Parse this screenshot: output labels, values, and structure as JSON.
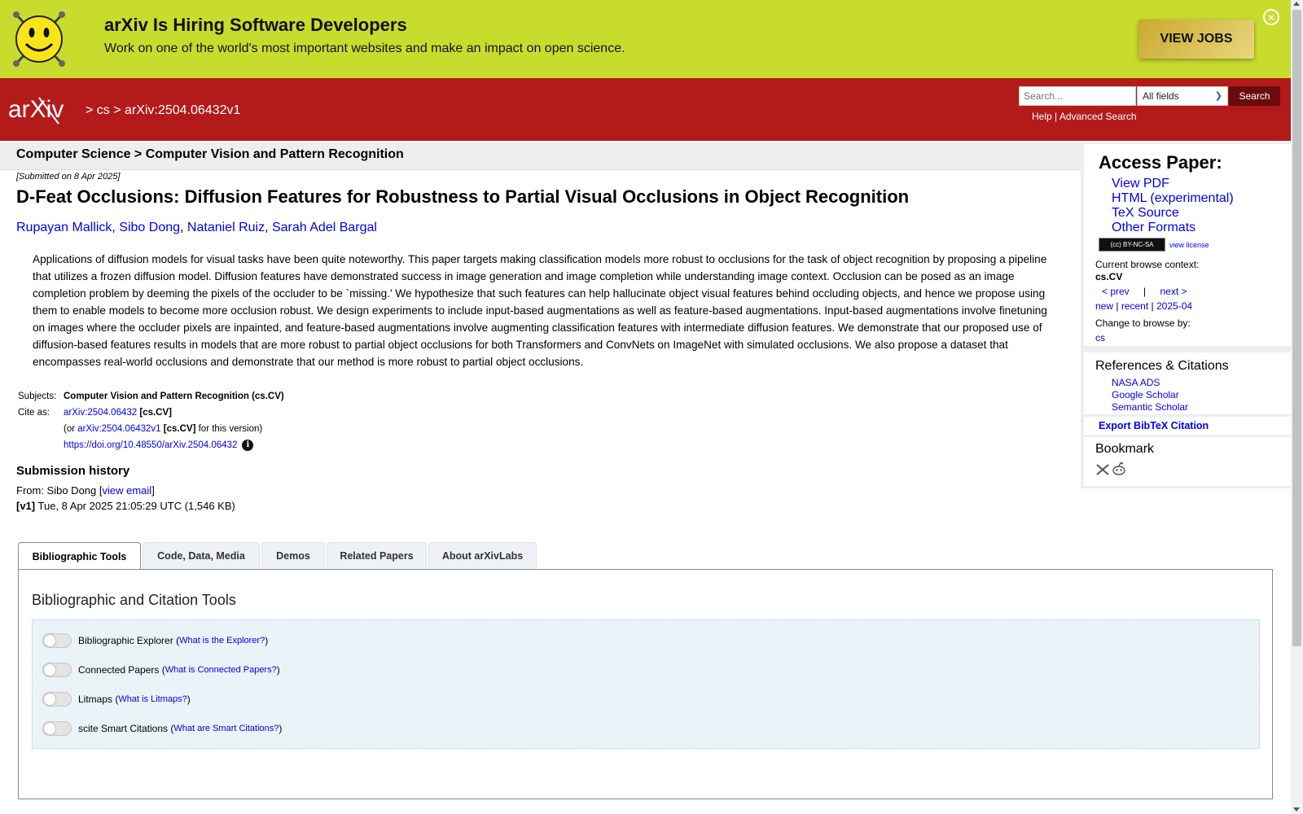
{
  "banner": {
    "title": "arXiv Is Hiring Software Developers",
    "subtitle": "Work on one of the world's most important websites and make an impact on open science.",
    "button": "VIEW JOBS",
    "close": "×"
  },
  "header": {
    "logo_text": "arXiv",
    "crumb_sep1": ">",
    "crumb_cs": "cs",
    "crumb_sep2": ">",
    "crumb_id": "arXiv:2504.06432v1",
    "search_placeholder": "Search...",
    "search_field": "All fields",
    "search_button": "Search",
    "help": "Help",
    "pipe": "|",
    "advanced": "Advanced Search"
  },
  "main": {
    "subject_header": "Computer Science > Computer Vision and Pattern Recognition",
    "submitted": "[Submitted on 8 Apr 2025]",
    "title": "D-Feat Occlusions: Diffusion Features for Robustness to Partial Visual Occlusions in Object Recognition",
    "authors": [
      "Rupayan Mallick",
      "Sibo Dong",
      "Nataniel Ruiz",
      "Sarah Adel Bargal"
    ],
    "author_sep": ",",
    "abstract": "Applications of diffusion models for visual tasks have been quite noteworthy. This paper targets making classification models more robust to occlusions for the task of object recognition by proposing a pipeline that utilizes a frozen diffusion model. Diffusion features have demonstrated success in image generation and image completion while understanding image context. Occlusion can be posed as an image completion problem by deeming the pixels of the occluder to be `missing.' We hypothesize that such features can help hallucinate object visual features behind occluding objects, and hence we propose using them to enable models to become more occlusion robust. We design experiments to include input-based augmentations as well as feature-based augmentations. Input-based augmentations involve finetuning on images where the occluder pixels are inpainted, and feature-based augmentations involve augmenting classification features with intermediate diffusion features. We demonstrate that our proposed use of diffusion-based features results in models that are more robust to partial object occlusions for both Transformers and ConvNets on ImageNet with simulated occlusions. We also propose a dataset that encompasses real-world occlusions and demonstrate that our method is more robust to partial object occlusions.",
    "meta": {
      "subjects_label": "Subjects:",
      "subjects_value": "Computer Vision and Pattern Recognition (cs.CV)",
      "cite_label": "Cite as:",
      "cite_id": "arXiv:2504.06432",
      "cite_cat": "[cs.CV]",
      "or_open": "(or",
      "cite_id_v1": "arXiv:2504.06432v1",
      "cite_cat2": "[cs.CV]",
      "or_close": "for this version)",
      "doi": "https://doi.org/10.48550/arXiv.2504.06432",
      "info": "i"
    },
    "history": {
      "title": "Submission history",
      "from_prefix": "From: Sibo Dong [",
      "view_email": "view email",
      "from_suffix": "]",
      "v1_label": "[v1]",
      "v1_text": "Tue, 8 Apr 2025 21:05:29 UTC (1,546 KB)"
    }
  },
  "sidebar": {
    "access_title": "Access Paper:",
    "links": [
      "View PDF",
      "HTML (experimental)",
      "TeX Source",
      "Other Formats"
    ],
    "license_badge": "(cc) BY-NC-SA",
    "view_license": "view license",
    "context_label": "Current browse context:",
    "context_value": "cs.CV",
    "prev": "< prev",
    "pipe": "|",
    "next": "next >",
    "new": "new",
    "recent": "recent",
    "month": "2025-04",
    "change_label": "Change to browse by:",
    "change_value": "cs",
    "refs_title": "References & Citations",
    "refs": [
      "NASA ADS",
      "Google Scholar",
      "Semantic Scholar"
    ],
    "export": "Export BibTeX Citation",
    "bookmark": "Bookmark"
  },
  "tabs": [
    "Bibliographic Tools",
    "Code, Data, Media",
    "Demos",
    "Related Papers",
    "About arXivLabs"
  ],
  "panel": {
    "title": "Bibliographic and Citation Tools",
    "tools": [
      {
        "name": "Bibliographic Explorer",
        "link": "What is the Explorer?"
      },
      {
        "name": "Connected Papers",
        "link": "What is Connected Papers?"
      },
      {
        "name": "Litmaps",
        "link": "What is Litmaps?"
      },
      {
        "name": "scite Smart Citations",
        "link": "What are Smart Citations?"
      }
    ]
  },
  "colors": {
    "banner_bg": "#c8dc2e",
    "header_bg": "#b31b1b",
    "link": "#0000ee",
    "search_btn": "#6b0c0c"
  }
}
